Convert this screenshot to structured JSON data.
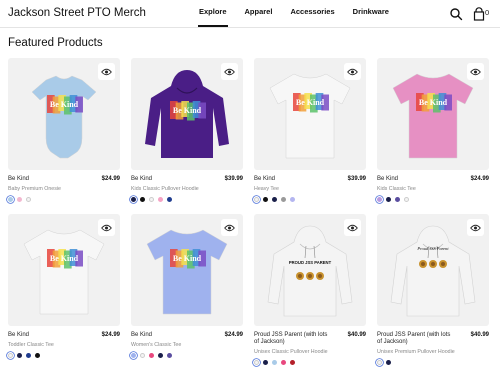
{
  "header": {
    "store_name": "Jackson Street PTO Merch",
    "nav": [
      "Explore",
      "Apparel",
      "Accessories",
      "Drinkware"
    ],
    "active_nav": "Explore",
    "icons": [
      "search-icon",
      "cart-icon"
    ],
    "cart_count": "0"
  },
  "section_title": "Featured Products",
  "products": [
    {
      "name": "Be Kind",
      "type": "Baby Premium Onesie",
      "price": "$24.99",
      "garment_color": "#a9cbe8",
      "swatches": [
        "#a9cbe8",
        "#f2b7cf",
        "#f4f4f4"
      ]
    },
    {
      "name": "Be Kind",
      "type": "Kids Classic Pullover Hoodie",
      "price": "$39.99",
      "garment_color": "#4a1e86",
      "swatches": [
        "#1a1f4a",
        "#111111",
        "#f4f4f4",
        "#f5a3c4",
        "#1f3c8f"
      ]
    },
    {
      "name": "Be Kind",
      "type": "Heavy Tee",
      "price": "$39.99",
      "garment_color": "#f7f7f7",
      "swatches": [
        "#f4f4f4",
        "#111111",
        "#1a1f4a",
        "#9a9a9a",
        "#b4b6f0"
      ]
    },
    {
      "name": "Be Kind",
      "type": "Kids Classic Tee",
      "price": "$24.99",
      "garment_color": "#e690c3",
      "swatches": [
        "#b99be0",
        "#1a1f4a",
        "#5b4ea0",
        "#f4f4f4"
      ]
    },
    {
      "name": "Be Kind",
      "type": "Toddler Classic Tee",
      "price": "$24.99",
      "garment_color": "#f7f7f7",
      "swatches": [
        "#f4f4f4",
        "#1a1f4a",
        "#1f3c8f",
        "#111111"
      ]
    },
    {
      "name": "Be Kind",
      "type": "Women's Classic Tee",
      "price": "$24.99",
      "garment_color": "#9fb2ee",
      "swatches": [
        "#9fb2ee",
        "#f4f4f4",
        "#e8487e",
        "#1a1f4a",
        "#5b4ea0"
      ]
    },
    {
      "name": "Proud JSS Parent (with lots of Jackson)",
      "type": "Unisex Classic Pullover Hoodie",
      "price": "$40.99",
      "garment_color": "#f4f4f4",
      "swatches": [
        "#f4f4f4",
        "#1a1f4a",
        "#a9cbe8",
        "#e8487e",
        "#b4202a"
      ]
    },
    {
      "name": "Proud JSS Parent (with lots of Jackson)",
      "type": "Unisex Premium Pullover Hoodie",
      "price": "$40.99",
      "garment_color": "#f4f4f4",
      "swatches": [
        "#f4f4f4",
        "#1a1f4a"
      ]
    }
  ],
  "design_text": {
    "be_kind": "Be Kind",
    "proud_hoodie": "PROUD JSS PARENT",
    "proud_script": "Proud JSS Parent"
  }
}
